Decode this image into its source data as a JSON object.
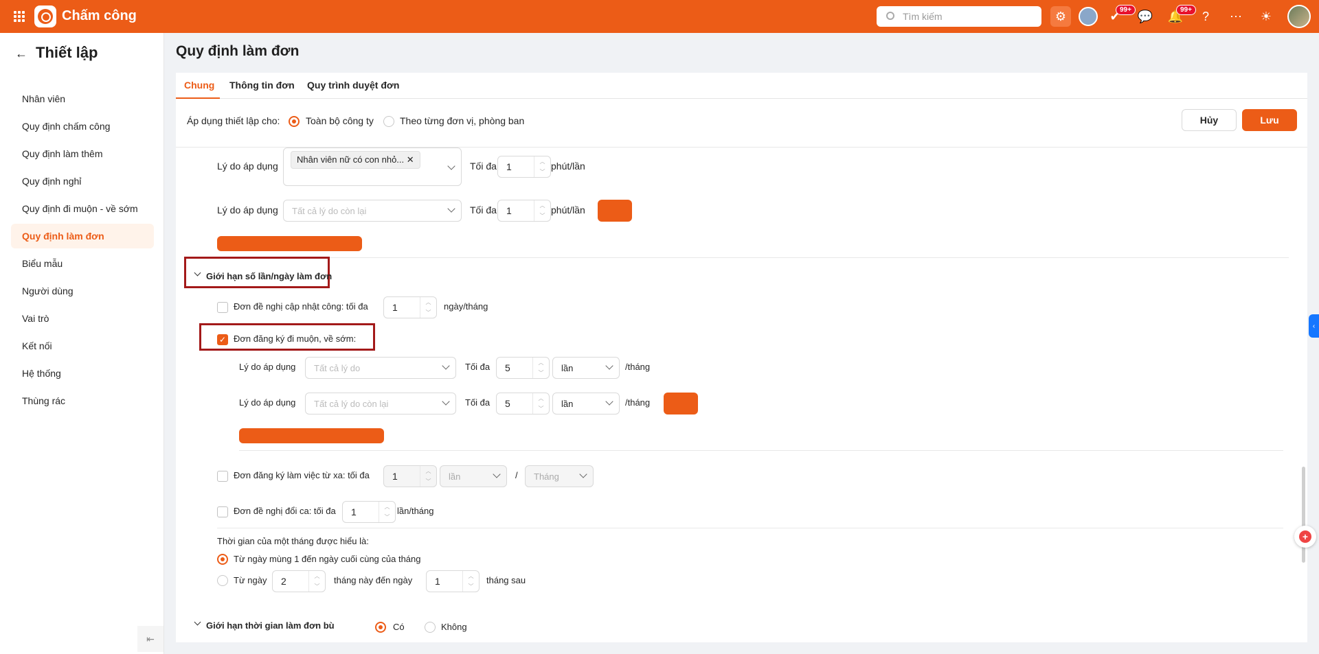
{
  "app": {
    "title": "Chấm công"
  },
  "topbar": {
    "search_placeholder": "Tìm kiếm",
    "badges": {
      "tasks": "99+",
      "notifications": "99+"
    }
  },
  "sidebar": {
    "title": "Thiết lập",
    "items": [
      {
        "label": "Nhân viên"
      },
      {
        "label": "Quy định chấm công"
      },
      {
        "label": "Quy định làm thêm"
      },
      {
        "label": "Quy định nghỉ"
      },
      {
        "label": "Quy định đi muộn - về sớm"
      },
      {
        "label": "Quy định làm đơn",
        "active": true
      },
      {
        "label": "Biểu mẫu"
      },
      {
        "label": "Người dùng"
      },
      {
        "label": "Vai trò"
      },
      {
        "label": "Kết nối"
      },
      {
        "label": "Hệ thống"
      },
      {
        "label": "Thùng rác"
      }
    ]
  },
  "page": {
    "title": "Quy định làm đơn"
  },
  "tabs": [
    {
      "label": "Chung",
      "active": true
    },
    {
      "label": "Thông tin đơn"
    },
    {
      "label": "Quy trình duyệt đơn"
    }
  ],
  "apply": {
    "label": "Áp dụng thiết lập cho:",
    "option_all": "Toàn bộ công ty",
    "option_unit": "Theo từng đơn vị, phòng ban",
    "selected": "all"
  },
  "actions": {
    "cancel": "Hủy",
    "save": "Lưu"
  },
  "top_rules": {
    "row1": {
      "label": "Lý do áp dụng",
      "tag": "Nhân viên nữ có con nhỏ...",
      "max_label": "Tối đa",
      "value": "1",
      "unit": "phút/lần"
    },
    "row2": {
      "label": "Lý do áp dụng",
      "placeholder": "Tất cả lý do còn lại",
      "max_label": "Tối đa",
      "value": "1",
      "unit": "phút/lần"
    }
  },
  "limit_section": {
    "title": "Giới hạn số lần/ngày làm đơn",
    "update_request": {
      "label": "Đơn đề nghị cập nhật công: tối đa",
      "checked": false,
      "value": "1",
      "unit": "ngày/tháng"
    },
    "late_early": {
      "label": "Đơn đăng ký đi muộn, về sớm:",
      "checked": true,
      "rows": [
        {
          "label": "Lý do áp dụng",
          "placeholder": "Tất cả lý do",
          "max_label": "Tối đa",
          "value": "5",
          "unit": "lần",
          "per": "/tháng"
        },
        {
          "label": "Lý do áp dụng",
          "placeholder": "Tất cả lý do còn lại",
          "max_label": "Tối đa",
          "value": "5",
          "unit": "lần",
          "per": "/tháng"
        }
      ]
    },
    "remote": {
      "label": "Đơn đăng ký làm việc từ xa: tối đa",
      "checked": false,
      "value": "1",
      "unit": "lần",
      "separator": "/",
      "period": "Tháng"
    },
    "shift_swap": {
      "label": "Đơn đề nghị đổi ca: tối đa",
      "checked": false,
      "value": "1",
      "unit": "lần/tháng"
    },
    "month_def": {
      "title": "Thời gian của một tháng được hiểu là:",
      "option1": "Từ ngày mùng 1 đến ngày cuối cùng của tháng",
      "option2_prefix": "Từ ngày",
      "option2_from": "2",
      "option2_mid": "tháng này đến ngày",
      "option2_to": "1",
      "option2_suffix": "tháng sau",
      "selected": "option1"
    }
  },
  "compensation_section": {
    "title": "Giới hạn thời gian làm đơn bù",
    "yes": "Có",
    "no": "Không",
    "selected": "yes"
  },
  "colors": {
    "brand": "#ec5c17",
    "highlight_box": "#a31919"
  }
}
